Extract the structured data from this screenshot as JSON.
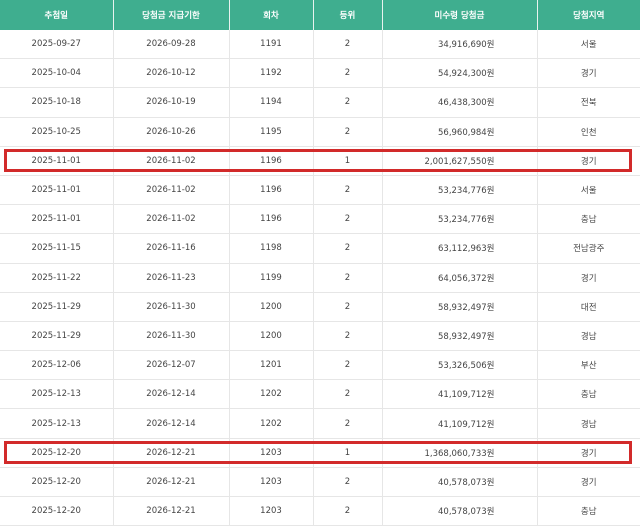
{
  "columns": [
    "추첨일",
    "당첨금 지급기한",
    "회차",
    "등위",
    "미수령 당첨금",
    "당첨지역"
  ],
  "rows": [
    [
      "2025-09-27",
      "2026-09-28",
      "1191",
      "2",
      "34,916,690원",
      "서울"
    ],
    [
      "2025-10-04",
      "2026-10-12",
      "1192",
      "2",
      "54,924,300원",
      "경기"
    ],
    [
      "2025-10-18",
      "2026-10-19",
      "1194",
      "2",
      "46,438,300원",
      "전북"
    ],
    [
      "2025-10-25",
      "2026-10-26",
      "1195",
      "2",
      "56,960,984원",
      "인천"
    ],
    [
      "2025-11-01",
      "2026-11-02",
      "1196",
      "1",
      "2,001,627,550원",
      "경기"
    ],
    [
      "2025-11-01",
      "2026-11-02",
      "1196",
      "2",
      "53,234,776원",
      "서울"
    ],
    [
      "2025-11-01",
      "2026-11-02",
      "1196",
      "2",
      "53,234,776원",
      "충남"
    ],
    [
      "2025-11-15",
      "2026-11-16",
      "1198",
      "2",
      "63,112,963원",
      "전남광주"
    ],
    [
      "2025-11-22",
      "2026-11-23",
      "1199",
      "2",
      "64,056,372원",
      "경기"
    ],
    [
      "2025-11-29",
      "2026-11-30",
      "1200",
      "2",
      "58,932,497원",
      "대전"
    ],
    [
      "2025-11-29",
      "2026-11-30",
      "1200",
      "2",
      "58,932,497원",
      "경남"
    ],
    [
      "2025-12-06",
      "2026-12-07",
      "1201",
      "2",
      "53,326,506원",
      "부산"
    ],
    [
      "2025-12-13",
      "2026-12-14",
      "1202",
      "2",
      "41,109,712원",
      "충남"
    ],
    [
      "2025-12-13",
      "2026-12-14",
      "1202",
      "2",
      "41,109,712원",
      "경남"
    ],
    [
      "2025-12-20",
      "2026-12-21",
      "1203",
      "1",
      "1,368,060,733원",
      "경기"
    ],
    [
      "2025-12-20",
      "2026-12-21",
      "1203",
      "2",
      "40,578,073원",
      "경기"
    ],
    [
      "2025-12-20",
      "2026-12-21",
      "1203",
      "2",
      "40,578,073원",
      "충남"
    ]
  ],
  "highlighted_rows": [
    4,
    14
  ],
  "colors": {
    "header_bg": "#3fae8f",
    "highlight_border": "#d22a2a"
  }
}
